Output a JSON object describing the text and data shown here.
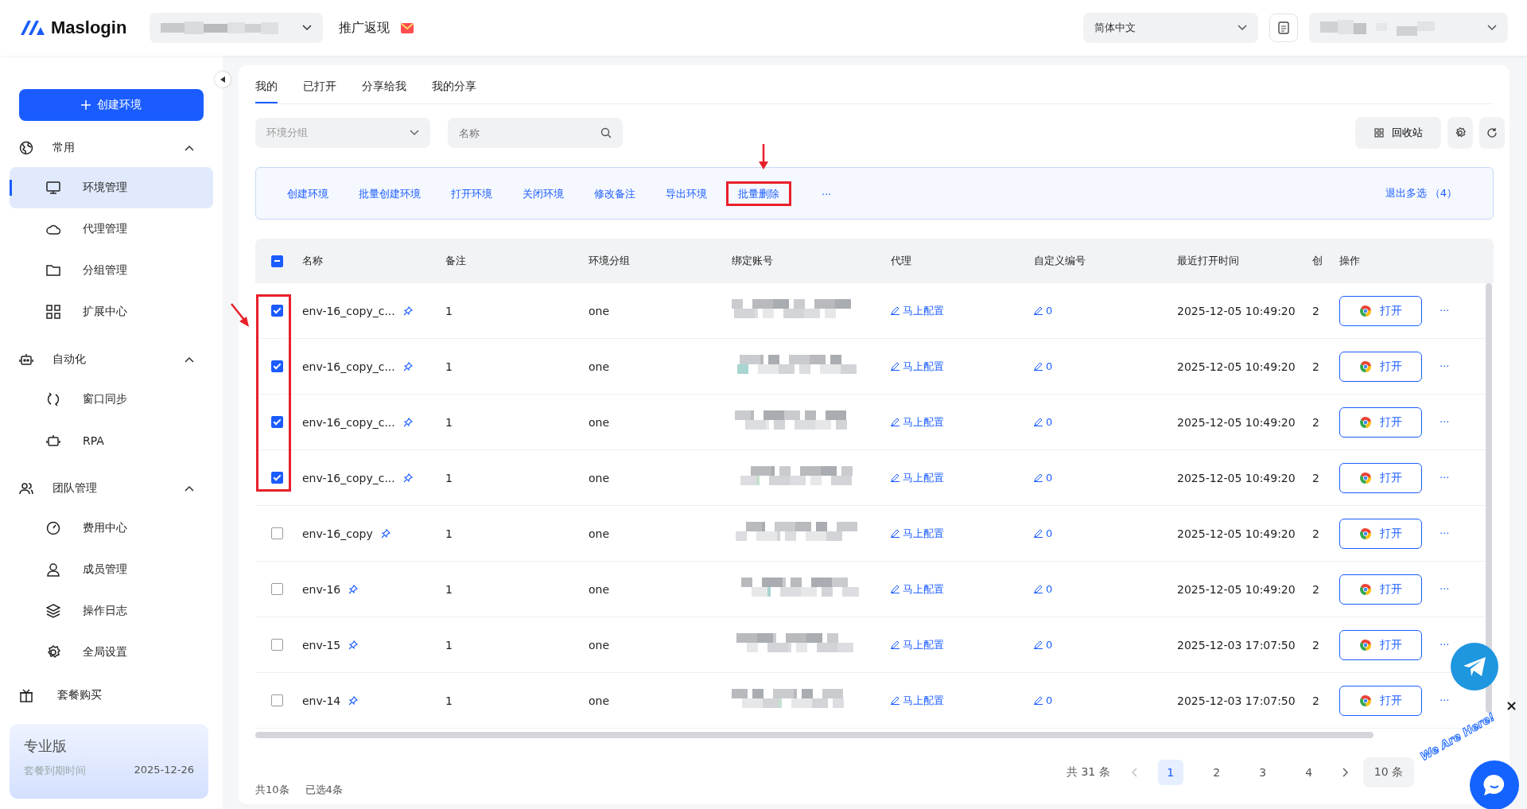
{
  "header": {
    "logo": "Maslogin",
    "promo": "推广返现",
    "language": "简体中文"
  },
  "sidebar": {
    "create_button": "创建环境",
    "groups": [
      {
        "label": "常用",
        "expanded": true,
        "children": [
          {
            "label": "环境管理",
            "selected": true
          },
          {
            "label": "代理管理",
            "selected": false
          },
          {
            "label": "分组管理",
            "selected": false
          },
          {
            "label": "扩展中心",
            "selected": false
          }
        ]
      },
      {
        "label": "自动化",
        "expanded": true,
        "children": [
          {
            "label": "窗口同步",
            "selected": false
          },
          {
            "label": "RPA",
            "selected": false
          }
        ]
      },
      {
        "label": "团队管理",
        "expanded": true,
        "children": [
          {
            "label": "费用中心",
            "selected": false
          },
          {
            "label": "成员管理",
            "selected": false
          },
          {
            "label": "操作日志",
            "selected": false
          },
          {
            "label": "全局设置",
            "selected": false
          }
        ]
      }
    ],
    "purchase": "套餐购买",
    "plan": {
      "name": "专业版",
      "expiry_label": "套餐到期时间",
      "expiry_date": "2025-12-26"
    }
  },
  "tabs": [
    {
      "label": "我的",
      "selected": true
    },
    {
      "label": "已打开",
      "selected": false
    },
    {
      "label": "分享给我",
      "selected": false
    },
    {
      "label": "我的分享",
      "selected": false
    }
  ],
  "filters": {
    "group_placeholder": "环境分组",
    "search_placeholder": "名称",
    "recycle": "回收站"
  },
  "actions": {
    "items": [
      {
        "label": "创建环境",
        "annotated": false
      },
      {
        "label": "批量创建环境",
        "annotated": false
      },
      {
        "label": "打开环境",
        "annotated": false
      },
      {
        "label": "关闭环境",
        "annotated": false
      },
      {
        "label": "修改备注",
        "annotated": false
      },
      {
        "label": "导出环境",
        "annotated": false
      },
      {
        "label": "批量删除",
        "annotated": true
      },
      {
        "label": "···",
        "annotated": false
      }
    ],
    "exit": "退出多选",
    "count": "（4）"
  },
  "table": {
    "select_all": {
      "indeterminate": true
    },
    "columns": [
      "名称",
      "备注",
      "环境分组",
      "绑定账号",
      "代理",
      "自定义编号",
      "最近打开时间",
      "创",
      "操作"
    ],
    "rows": [
      {
        "name": "env-16_copy_c...",
        "remark": "1",
        "group": "one",
        "proxy": "马上配置",
        "custom": "0",
        "last_opened": "2025-12-05 10:49:20",
        "created": "2",
        "open": "打开",
        "more": "···",
        "checked": true
      },
      {
        "name": "env-16_copy_c...",
        "remark": "1",
        "group": "one",
        "proxy": "马上配置",
        "custom": "0",
        "last_opened": "2025-12-05 10:49:20",
        "created": "2",
        "open": "打开",
        "more": "···",
        "checked": true
      },
      {
        "name": "env-16_copy_c...",
        "remark": "1",
        "group": "one",
        "proxy": "马上配置",
        "custom": "0",
        "last_opened": "2025-12-05 10:49:20",
        "created": "2",
        "open": "打开",
        "more": "···",
        "checked": true
      },
      {
        "name": "env-16_copy_c...",
        "remark": "1",
        "group": "one",
        "proxy": "马上配置",
        "custom": "0",
        "last_opened": "2025-12-05 10:49:20",
        "created": "2",
        "open": "打开",
        "more": "···",
        "checked": true
      },
      {
        "name": "env-16_copy",
        "remark": "1",
        "group": "one",
        "proxy": "马上配置",
        "custom": "0",
        "last_opened": "2025-12-05 10:49:20",
        "created": "2",
        "open": "打开",
        "more": "···",
        "checked": false
      },
      {
        "name": "env-16",
        "remark": "1",
        "group": "one",
        "proxy": "马上配置",
        "custom": "0",
        "last_opened": "2025-12-05 10:49:20",
        "created": "2",
        "open": "打开",
        "more": "···",
        "checked": false
      },
      {
        "name": "env-15",
        "remark": "1",
        "group": "one",
        "proxy": "马上配置",
        "custom": "0",
        "last_opened": "2025-12-03 17:07:50",
        "created": "2",
        "open": "打开",
        "more": "···",
        "checked": false
      },
      {
        "name": "env-14",
        "remark": "1",
        "group": "one",
        "proxy": "马上配置",
        "custom": "0",
        "last_opened": "2025-12-03 17:07:50",
        "created": "2",
        "open": "打开",
        "more": "···",
        "checked": false
      }
    ]
  },
  "pagination": {
    "total": "共 31 条",
    "pages": [
      {
        "label": "1",
        "selected": true
      },
      {
        "label": "2",
        "selected": false
      },
      {
        "label": "3",
        "selected": false
      },
      {
        "label": "4",
        "selected": false
      }
    ],
    "page_size": "10 条"
  },
  "footer": {
    "total": "共10条",
    "selected": "已选4条"
  },
  "chat_widget": {
    "badge": "We Are Here!",
    "close": "×"
  }
}
